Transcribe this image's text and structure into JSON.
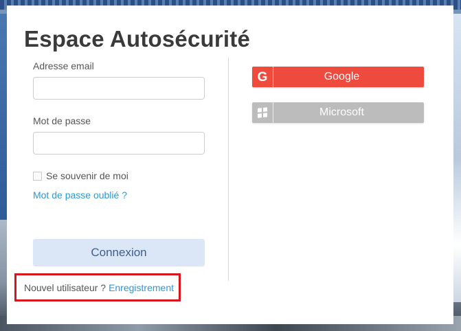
{
  "page": {
    "title": "Espace Autosécurité"
  },
  "form": {
    "email_label": "Adresse email",
    "email_value": "",
    "password_label": "Mot de passe",
    "password_value": "",
    "remember_label": "Se souvenir de moi",
    "forgot_label": "Mot de passe oublié ?",
    "login_label": "Connexion"
  },
  "signup": {
    "text": "Nouvel utilisateur ?",
    "link": "Enregistrement"
  },
  "social": {
    "google_label": "Google",
    "google_icon": "google-g-icon",
    "microsoft_label": "Microsoft",
    "microsoft_icon": "windows-logo-icon"
  },
  "colors": {
    "google": "#ef4a3e",
    "microsoft": "#bcbcbc",
    "login_button": "#dbe6f7",
    "link": "#2a9ad3",
    "highlight_border": "#d9141a"
  }
}
